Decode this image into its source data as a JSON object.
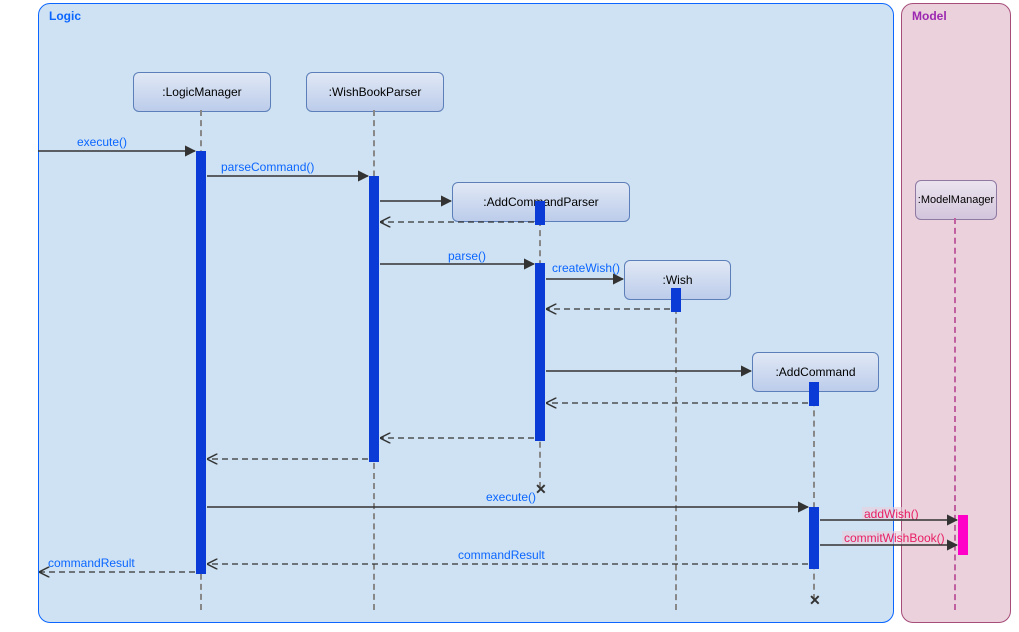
{
  "frames": {
    "logic": "Logic",
    "model": "Model"
  },
  "lifelines": {
    "lm": ":LogicManager",
    "wbp": ":WishBookParser",
    "acp": ":AddCommandParser",
    "wish": ":Wish",
    "ac": ":AddCommand",
    "mm": ":ModelManager"
  },
  "messages": {
    "execute": "execute()",
    "parseCommand": "parseCommand()",
    "parse": "parse()",
    "createWish": "createWish()",
    "execute2": "execute()",
    "addWish": "addWish()",
    "commitWishBook": "commitWishBook()",
    "commandResult": "commandResult",
    "commandResult2": "commandResult"
  },
  "chart_data": {
    "type": "sequence-diagram",
    "frames": [
      {
        "name": "Logic",
        "participants": [
          "LogicManager",
          "WishBookParser",
          "AddCommandParser",
          "Wish",
          "AddCommand"
        ]
      },
      {
        "name": "Model",
        "participants": [
          "ModelManager"
        ]
      }
    ],
    "participants": [
      "LogicManager",
      "WishBookParser",
      "AddCommandParser",
      "Wish",
      "AddCommand",
      "ModelManager"
    ],
    "created_during_interaction": [
      "AddCommandParser",
      "Wish",
      "AddCommand"
    ],
    "destroyed_during_interaction": [
      "AddCommandParser",
      "AddCommand"
    ],
    "messages": [
      {
        "from": "(external)",
        "to": "LogicManager",
        "label": "execute()",
        "type": "sync"
      },
      {
        "from": "LogicManager",
        "to": "WishBookParser",
        "label": "parseCommand()",
        "type": "sync"
      },
      {
        "from": "WishBookParser",
        "to": "AddCommandParser",
        "label": "(create)",
        "type": "create"
      },
      {
        "from": "AddCommandParser",
        "to": "WishBookParser",
        "label": "",
        "type": "return"
      },
      {
        "from": "WishBookParser",
        "to": "AddCommandParser",
        "label": "parse()",
        "type": "sync"
      },
      {
        "from": "AddCommandParser",
        "to": "Wish",
        "label": "createWish()",
        "type": "create"
      },
      {
        "from": "Wish",
        "to": "AddCommandParser",
        "label": "",
        "type": "return"
      },
      {
        "from": "AddCommandParser",
        "to": "AddCommand",
        "label": "(create)",
        "type": "create"
      },
      {
        "from": "AddCommand",
        "to": "AddCommandParser",
        "label": "",
        "type": "return"
      },
      {
        "from": "AddCommandParser",
        "to": "WishBookParser",
        "label": "",
        "type": "return"
      },
      {
        "from": "WishBookParser",
        "to": "LogicManager",
        "label": "",
        "type": "return"
      },
      {
        "from": "LogicManager",
        "to": "AddCommand",
        "label": "execute()",
        "type": "sync"
      },
      {
        "from": "AddCommand",
        "to": "ModelManager",
        "label": "addWish()",
        "type": "sync"
      },
      {
        "from": "AddCommand",
        "to": "ModelManager",
        "label": "commitWishBook()",
        "type": "sync"
      },
      {
        "from": "AddCommand",
        "to": "LogicManager",
        "label": "commandResult",
        "type": "return"
      },
      {
        "from": "LogicManager",
        "to": "(external)",
        "label": "commandResult",
        "type": "return"
      }
    ]
  }
}
